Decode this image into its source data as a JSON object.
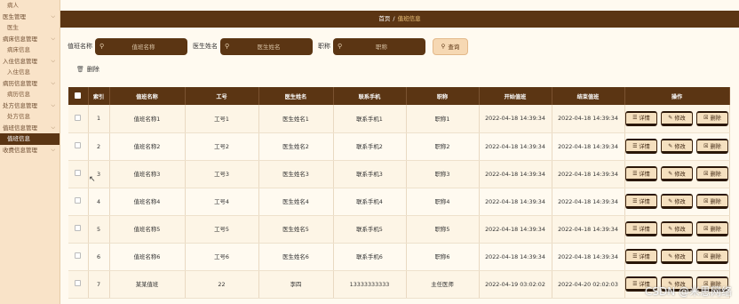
{
  "sidebar": {
    "items": [
      {
        "label": "病人",
        "type": "child"
      },
      {
        "label": "医生管理",
        "type": "group"
      },
      {
        "label": "医生",
        "type": "child"
      },
      {
        "label": "病床信息管理",
        "type": "group"
      },
      {
        "label": "病床信息",
        "type": "child"
      },
      {
        "label": "入住信息管理",
        "type": "group"
      },
      {
        "label": "入住信息",
        "type": "child"
      },
      {
        "label": "病历信息管理",
        "type": "group"
      },
      {
        "label": "病历信息",
        "type": "child"
      },
      {
        "label": "处方信息管理",
        "type": "group"
      },
      {
        "label": "处方信息",
        "type": "child"
      },
      {
        "label": "值班信息管理",
        "type": "group"
      },
      {
        "label": "值班信息",
        "type": "active"
      },
      {
        "label": "收费信息管理",
        "type": "group"
      }
    ]
  },
  "breadcrumb": {
    "home": "首页",
    "separator": "/",
    "current": "值班信息"
  },
  "search": {
    "duty_label": "值班名称",
    "duty_placeholder": "值班名称",
    "doctor_label": "医生姓名",
    "doctor_placeholder": "医生姓名",
    "title_label": "职称",
    "title_placeholder": "职称",
    "query_label": "查询"
  },
  "toolbar": {
    "delete_label": "删除"
  },
  "table": {
    "headers": [
      "索引",
      "值班名称",
      "工号",
      "医生姓名",
      "联系手机",
      "职称",
      "开始值班",
      "结束值班",
      "操作"
    ],
    "actions": {
      "detail": "详情",
      "edit": "修改",
      "delete": "删除"
    },
    "rows": [
      {
        "index": "1",
        "duty": "值班名称1",
        "no": "工号1",
        "doctor": "医生姓名1",
        "phone": "联系手机1",
        "title": "职称1",
        "start": "2022-04-18 14:39:34",
        "end": "2022-04-18 14:39:34"
      },
      {
        "index": "2",
        "duty": "值班名称2",
        "no": "工号2",
        "doctor": "医生姓名2",
        "phone": "联系手机2",
        "title": "职称2",
        "start": "2022-04-18 14:39:34",
        "end": "2022-04-18 14:39:34"
      },
      {
        "index": "3",
        "duty": "值班名称3",
        "no": "工号3",
        "doctor": "医生姓名3",
        "phone": "联系手机3",
        "title": "职称3",
        "start": "2022-04-18 14:39:34",
        "end": "2022-04-18 14:39:34"
      },
      {
        "index": "4",
        "duty": "值班名称4",
        "no": "工号4",
        "doctor": "医生姓名4",
        "phone": "联系手机4",
        "title": "职称4",
        "start": "2022-04-18 14:39:34",
        "end": "2022-04-18 14:39:34"
      },
      {
        "index": "5",
        "duty": "值班名称5",
        "no": "工号5",
        "doctor": "医生姓名5",
        "phone": "联系手机5",
        "title": "职称5",
        "start": "2022-04-18 14:39:34",
        "end": "2022-04-18 14:39:34"
      },
      {
        "index": "6",
        "duty": "值班名称6",
        "no": "工号6",
        "doctor": "医生姓名6",
        "phone": "联系手机6",
        "title": "职称6",
        "start": "2022-04-18 14:39:34",
        "end": "2022-04-18 14:39:34"
      },
      {
        "index": "7",
        "duty": "某某值班",
        "no": "22",
        "doctor": "李四",
        "phone": "13333333333",
        "title": "主任医师",
        "start": "2022-04-19 03:02:02",
        "end": "2022-04-20 02:02:03"
      }
    ]
  },
  "watermark": "CSDN @米思网络",
  "colors": {
    "primary": "#5b3513",
    "sidebar_bg": "#f9e3c8",
    "button_bg": "#f5e0bf"
  }
}
